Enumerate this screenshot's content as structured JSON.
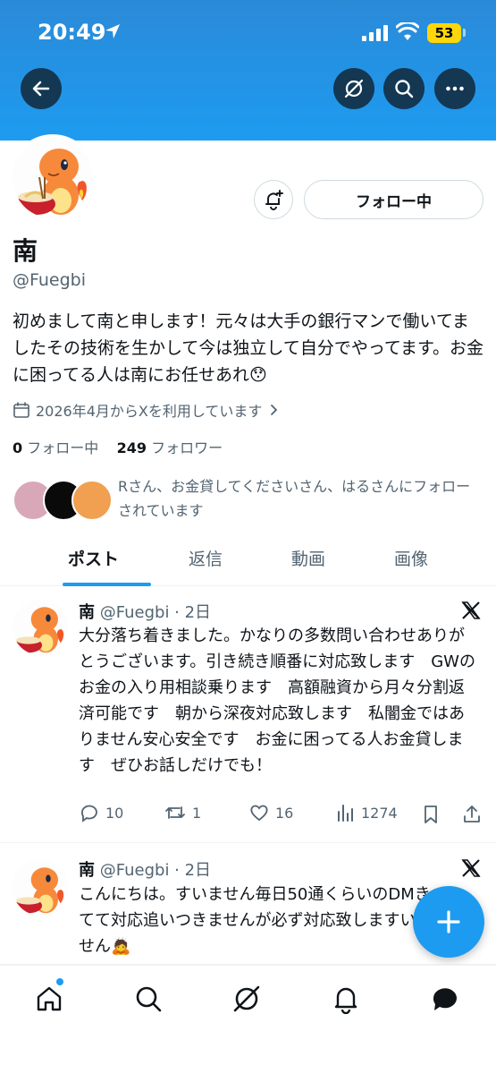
{
  "status_bar": {
    "time": "20:49",
    "battery": "53",
    "battery_color": "#ffd60a"
  },
  "header": {
    "banner_color": "#1d9bf0"
  },
  "profile": {
    "follow_label": "フォロー中",
    "name": "南",
    "handle": "@Fuegbi",
    "bio": "初めまして南と申します！元々は大手の銀行マンで働いてましたその技術を生かして今は独立して自分でやってます。お金に困ってる人は南にお任せあれ😯",
    "joined": "2026年4月からXを利用しています",
    "following_count": "0",
    "following_label": "フォロー中",
    "followers_count": "249",
    "followers_label": "フォロワー",
    "followed_by": "Rさん、お金貸してくださいさん、はるさんにフォローされています"
  },
  "tabs": [
    "ポスト",
    "返信",
    "動画",
    "画像"
  ],
  "posts": [
    {
      "name": "南",
      "meta": "@Fuegbi · 2日",
      "text": "大分落ち着きました。かなりの多数問い合わせありがとうございます。引き続き順番に対応致します　GWのお金の入り用相談乗ります　高額融資から月々分割返済可能です　朝から深夜対応致します　私闇金ではありません安心安全です　お金に困ってる人お金貸します　ぜひお話しだけでも！",
      "replies": "10",
      "reposts": "1",
      "likes": "16",
      "views": "1274"
    },
    {
      "name": "南",
      "meta": "@Fuegbi · 2日",
      "text": "こんにちは。すいません毎日50通くらいのDMきてて対応追いつきませんが必ず対応致しますいません🙇"
    }
  ],
  "accent_color": "#1d9bf0"
}
